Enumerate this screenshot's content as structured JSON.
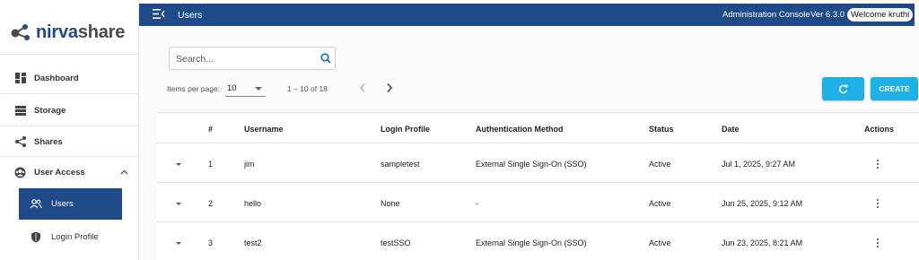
{
  "app": {
    "logo_part1": "nirva",
    "logo_part2": "share"
  },
  "sidebar": {
    "items": [
      {
        "label": "Dashboard",
        "icon": "dashboard-icon"
      },
      {
        "label": "Storage",
        "icon": "storage-icon"
      },
      {
        "label": "Shares",
        "icon": "share-icon"
      },
      {
        "label": "User Access",
        "icon": "user-access-icon",
        "expanded": true
      }
    ],
    "subitems": [
      {
        "label": "Users",
        "icon": "users-icon",
        "active": true
      },
      {
        "label": "Login Profile",
        "icon": "shield-icon",
        "active": false
      }
    ]
  },
  "header": {
    "title": "Users",
    "admin_label": "Administration Console",
    "version": "Ver 6.3.0",
    "welcome": "Welcome kruthi"
  },
  "toolbar": {
    "search_placeholder": "Search...",
    "items_per_page_label": "Items per page:",
    "items_per_page_value": "10",
    "range_label": "1 – 10 of 18",
    "create_label": "CREATE"
  },
  "table": {
    "columns": [
      "#",
      "Username",
      "Login Profile",
      "Authentication Method",
      "Status",
      "Date",
      "Actions"
    ],
    "rows": [
      {
        "num": "1",
        "username": "jim",
        "login_profile": "sampletest",
        "auth_method": "External Single Sign-On (SSO)",
        "status": "Active",
        "date": "Jul 1, 2025, 9:27 AM"
      },
      {
        "num": "2",
        "username": "hello",
        "login_profile": "None",
        "auth_method": "-",
        "status": "Active",
        "date": "Jun 25, 2025, 9:12 AM"
      },
      {
        "num": "3",
        "username": "test2",
        "login_profile": "testSSO",
        "auth_method": "External Single Sign-On (SSO)",
        "status": "Active",
        "date": "Jun 23, 2025, 8:21 AM"
      }
    ]
  },
  "colors": {
    "brand": "#1f4a8a",
    "accent": "#1fb0e6"
  }
}
